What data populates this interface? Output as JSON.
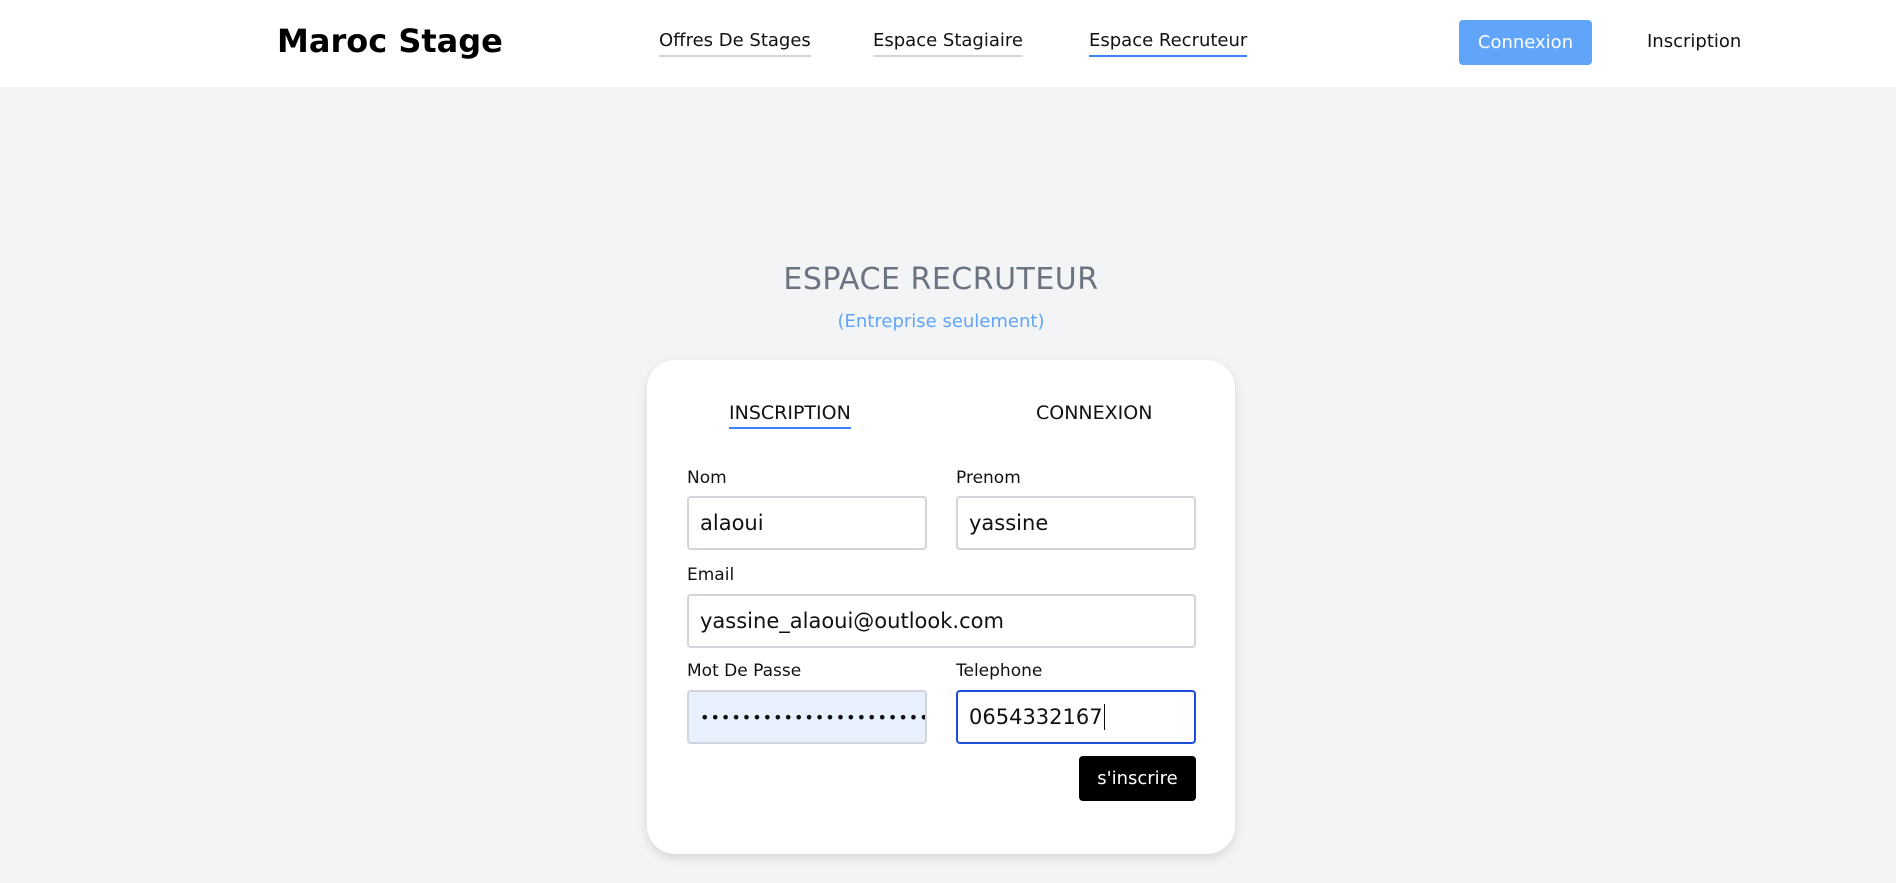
{
  "header": {
    "brand": "Maroc Stage",
    "nav": {
      "offres": "Offres De Stages",
      "stagiaire": "Espace Stagiaire",
      "recruteur": "Espace Recruteur"
    },
    "connexion_label": "Connexion",
    "inscription_label": "Inscription"
  },
  "page": {
    "title": "ESPACE RECRUTEUR",
    "subtitle": "(Entreprise seulement)"
  },
  "form": {
    "tabs": {
      "inscription": "INSCRIPTION",
      "connexion": "CONNEXION"
    },
    "fields": {
      "nom": {
        "label": "Nom",
        "value": "alaoui"
      },
      "prenom": {
        "label": "Prenom",
        "value": "yassine"
      },
      "email": {
        "label": "Email",
        "value": "yassine_alaoui@outlook.com"
      },
      "mot_de_passe": {
        "label": "Mot De Passe",
        "value": "••••••••••••••••••••••••"
      },
      "telephone": {
        "label": "Telephone",
        "value": "0654332167"
      }
    },
    "submit_label": "s'inscrire"
  },
  "colors": {
    "accent": "#60a5fa",
    "underline": "#3b82f6",
    "focus": "#1d4ed8",
    "background": "#f3f4f6"
  }
}
